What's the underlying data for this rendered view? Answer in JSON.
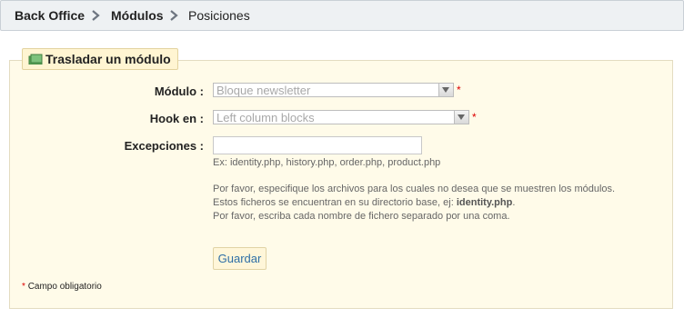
{
  "breadcrumb": {
    "items": [
      "Back Office",
      "Módulos",
      "Posiciones"
    ]
  },
  "panel": {
    "legend": "Trasladar un módulo",
    "fields": {
      "module_label": "Módulo :",
      "module_value": "Bloque newsletter",
      "hook_label": "Hook en :",
      "hook_value": "Left column blocks",
      "exceptions_label": "Excepciones :",
      "exceptions_value": ""
    },
    "required_mark": "*",
    "hint_example": "Ex: identity.php, history.php, order.php, product.php",
    "hint_line1": "Por favor, especifique los archivos para los cuales no desea que se muestren los módulos.",
    "hint_line2_pre": "Estos ficheros se encuentran en su directorio base, ej: ",
    "hint_line2_bold": "identity.php",
    "hint_line2_post": ".",
    "hint_line3": "Por favor, escriba cada nombre de fichero separado por una coma.",
    "save_label": "Guardar",
    "footnote": "Campo obligatorio"
  },
  "colors": {
    "panel_bg": "#fffbe9",
    "required": "#dd0000",
    "button_text": "#2f6fa6"
  },
  "icons": [
    "chevron-right-icon",
    "module-icon",
    "dropdown-arrow-icon"
  ]
}
